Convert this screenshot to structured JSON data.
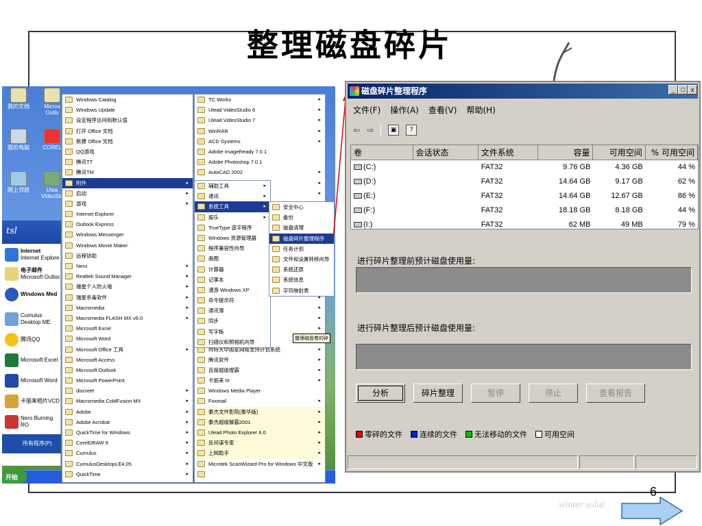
{
  "slide": {
    "title": "整理磁盘碎片",
    "page_number": "6",
    "footer_text": "winter solut"
  },
  "desktop": {
    "icons": [
      "我的文档",
      "Micros Outlo",
      "我的电脑",
      "COREL",
      "网上邻居",
      "Ulea VideoStu"
    ]
  },
  "start_menu": {
    "user": "tsl",
    "pinned": [
      {
        "title": "Internet",
        "subtitle": "Internet Explore"
      },
      {
        "title": "电子邮件",
        "subtitle": "Microsoft Outloc"
      },
      {
        "title": "Windows Med",
        "subtitle": ""
      }
    ],
    "recent": [
      "Cumulus Desktop ME",
      "腾讯QQ",
      "Microsoft Excel",
      "Microsoft Word",
      "卡丽来相片VCD",
      "Nero Burning RO"
    ],
    "all_programs": "所有程序(P)",
    "start_button": "开始"
  },
  "programs_menu": [
    {
      "label": "Windows Catalog",
      "arrow": false
    },
    {
      "label": "Windows Update",
      "arrow": false
    },
    {
      "label": "设定程序访问和默认值",
      "arrow": false
    },
    {
      "label": "打开 Office 文档",
      "arrow": false
    },
    {
      "label": "新建 Office 文档",
      "arrow": false
    },
    {
      "label": "QQ游戏",
      "arrow": false
    },
    {
      "label": "腾讯TT",
      "arrow": false
    },
    {
      "label": "腾讯TM",
      "arrow": false
    },
    {
      "label": "附件",
      "arrow": true
    },
    {
      "label": "启动",
      "arrow": true
    },
    {
      "label": "游戏",
      "arrow": true
    },
    {
      "label": "Internet Explorer",
      "arrow": false
    },
    {
      "label": "Outlook Express",
      "arrow": false
    },
    {
      "label": "Windows Messenger",
      "arrow": false
    },
    {
      "label": "Windows Movie Maker",
      "arrow": false
    },
    {
      "label": "远程协助",
      "arrow": false
    },
    {
      "label": "Nero",
      "arrow": true
    },
    {
      "label": "Realtek Sound Manager",
      "arrow": true
    },
    {
      "label": "瑞星个人防火墙",
      "arrow": true
    },
    {
      "label": "瑞星杀毒软件",
      "arrow": true
    },
    {
      "label": "Macromedia",
      "arrow": true
    },
    {
      "label": "Macromedia FLASH MX v6.0",
      "arrow": true
    },
    {
      "label": "Microsoft Excel",
      "arrow": false
    },
    {
      "label": "Microsoft Word",
      "arrow": false
    },
    {
      "label": "Microsoft Office 工具",
      "arrow": true
    },
    {
      "label": "Microsoft Access",
      "arrow": false
    },
    {
      "label": "Microsoft Outlook",
      "arrow": false
    },
    {
      "label": "Microsoft PowerPoint",
      "arrow": false
    },
    {
      "label": "discreet",
      "arrow": true
    },
    {
      "label": "Macromedia ColdFusion MX",
      "arrow": true
    },
    {
      "label": "Adobe",
      "arrow": true
    },
    {
      "label": "Adobe Acrobat",
      "arrow": true
    },
    {
      "label": "QuickTime for Windows",
      "arrow": true
    },
    {
      "label": "CorelDRAW 9",
      "arrow": true
    },
    {
      "label": "Cumulus",
      "arrow": true
    },
    {
      "label": "CumulusDesktopLE4.05",
      "arrow": true
    },
    {
      "label": "QuickTime",
      "arrow": true
    }
  ],
  "programs_menu2": [
    {
      "label": "TC Works",
      "arrow": true
    },
    {
      "label": "Ulead VideoStudio 6",
      "arrow": true
    },
    {
      "label": "Ulead VideoStudio 7",
      "arrow": true
    },
    {
      "label": "WinRAR",
      "arrow": true
    },
    {
      "label": "ACD Systems",
      "arrow": true
    },
    {
      "label": "Adobe ImageReady 7.0.1",
      "arrow": false
    },
    {
      "label": "Adobe Photoshop 7.0.1",
      "arrow": false
    },
    {
      "label": "AutoCAD 2002",
      "arrow": true
    },
    {
      "label": "",
      "arrow": true
    },
    {
      "label": "",
      "arrow": true
    },
    {
      "label": "",
      "arrow": true
    },
    {
      "label": "",
      "arrow": true
    },
    {
      "label": "",
      "arrow": true
    },
    {
      "label": "",
      "arrow": true
    },
    {
      "label": "",
      "arrow": true
    },
    {
      "label": "",
      "arrow": true
    },
    {
      "label": "",
      "arrow": true
    },
    {
      "label": "",
      "arrow": true
    },
    {
      "label": "",
      "arrow": true
    },
    {
      "label": "",
      "arrow": true
    },
    {
      "label": "",
      "arrow": true
    },
    {
      "label": "",
      "arrow": true
    },
    {
      "label": "",
      "arrow": true
    },
    {
      "label": "",
      "arrow": true
    },
    {
      "label": "向特大中国家网络支持计划系统",
      "arrow": true
    },
    {
      "label": "腾讯软件",
      "arrow": true
    },
    {
      "label": "百度超级搜霸",
      "arrow": true
    },
    {
      "label": "卡丽来 III",
      "arrow": true
    },
    {
      "label": "Windows Media Player",
      "arrow": false
    },
    {
      "label": "Foxmail",
      "arrow": true
    },
    {
      "label": "泰杰文件影院(泰华版)",
      "arrow": true
    },
    {
      "label": "泰杰超级解霸2001",
      "arrow": true
    },
    {
      "label": "Ulead Photo Explorer 6.0",
      "arrow": true
    },
    {
      "label": "反间谍专家",
      "arrow": true
    },
    {
      "label": "上网助手",
      "arrow": true
    },
    {
      "label": "Microtek ScanWizard Pro for Windows 中文版",
      "arrow": true
    },
    {
      "label": "",
      "arrow": false
    }
  ],
  "accessories_menu": [
    {
      "label": "辅助工具",
      "arrow": true
    },
    {
      "label": "通讯",
      "arrow": true
    },
    {
      "label": "系统工具",
      "arrow": true
    },
    {
      "label": "娱乐",
      "arrow": true
    },
    {
      "label": "TrueType 造字程序",
      "arrow": false
    },
    {
      "label": "Windows 资源管理器",
      "arrow": false
    },
    {
      "label": "程序兼容性向导",
      "arrow": false
    },
    {
      "label": "画图",
      "arrow": false
    },
    {
      "label": "计算器",
      "arrow": false
    },
    {
      "label": "记事本",
      "arrow": false
    },
    {
      "label": "漫游 Windows XP",
      "arrow": false
    },
    {
      "label": "命令提示符",
      "arrow": false
    },
    {
      "label": "通讯簿",
      "arrow": false
    },
    {
      "label": "同步",
      "arrow": false
    },
    {
      "label": "写字板",
      "arrow": false
    },
    {
      "label": "扫描仪和照相机向导",
      "arrow": false
    }
  ],
  "system_tools_menu": [
    {
      "label": "安全中心"
    },
    {
      "label": "备份"
    },
    {
      "label": "磁盘清理"
    },
    {
      "label": "磁盘碎片整理程序"
    },
    {
      "label": "任务计划"
    },
    {
      "label": "文件和设置转移向导"
    },
    {
      "label": "系统还原"
    },
    {
      "label": "系统信息"
    },
    {
      "label": "字符映射表"
    }
  ],
  "tooltip": "整理磁盘卷的碎",
  "defrag": {
    "title": "磁盘碎片整理程序",
    "menu": [
      "文件(F)",
      "操作(A)",
      "查看(V)",
      "帮助(H)"
    ],
    "columns": [
      "卷",
      "会话状态",
      "文件系统",
      "容量",
      "可用空间",
      "% 可用空间"
    ],
    "rows": [
      {
        "volume": "(C:)",
        "status": "",
        "fs": "FAT32",
        "capacity": "9.76 GB",
        "free": "4.36 GB",
        "pct": "44 %"
      },
      {
        "volume": "(D:)",
        "status": "",
        "fs": "FAT32",
        "capacity": "14.64 GB",
        "free": "9.17 GB",
        "pct": "62 %"
      },
      {
        "volume": "(E:)",
        "status": "",
        "fs": "FAT32",
        "capacity": "14.64 GB",
        "free": "12.67 GB",
        "pct": "86 %"
      },
      {
        "volume": "(F:)",
        "status": "",
        "fs": "FAT32",
        "capacity": "18.18 GB",
        "free": "8.18 GB",
        "pct": "44 %"
      },
      {
        "volume": "(I:)",
        "status": "",
        "fs": "FAT32",
        "capacity": "62 MB",
        "free": "49 MB",
        "pct": "79 %"
      }
    ],
    "before_label": "进行碎片整理前预计磁盘使用量:",
    "after_label": "进行碎片整理后预计磁盘使用量:",
    "buttons": {
      "analyze": "分析",
      "defrag": "碎片整理",
      "pause": "暂停",
      "stop": "停止",
      "report": "查看报告"
    },
    "legend": [
      {
        "label": "零碎的文件",
        "color": "#e00000"
      },
      {
        "label": "连续的文件",
        "color": "#0020d0"
      },
      {
        "label": "无法移动的文件",
        "color": "#00c000"
      },
      {
        "label": "可用空间",
        "color": "#ffffff"
      }
    ]
  },
  "colors": {
    "menu_highlight": "#1c3b94",
    "title_bar": "#0a246a",
    "pointer_line": "#e00000"
  }
}
